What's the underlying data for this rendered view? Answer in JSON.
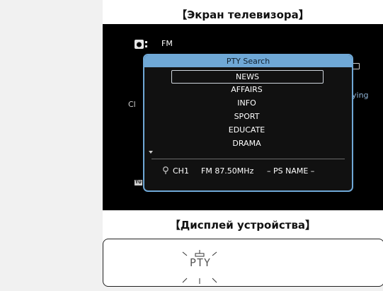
{
  "captions": {
    "tv_screen": "【Экран телевизора】",
    "device_display": "【Дисплей устройства】"
  },
  "tv": {
    "band": "FM",
    "left_text": "Cl",
    "right_text": "ying",
    "tu_badge": "TU",
    "icons": [
      "tuner-icon",
      "display-icon"
    ]
  },
  "dialog": {
    "title": "PTY Search",
    "items": [
      "NEWS",
      "AFFAIRS",
      "INFO",
      "SPORT",
      "EDUCATE",
      "DRAMA"
    ],
    "selected_item": "NEWS",
    "status": {
      "channel": "CH1",
      "frequency": "FM 87.50MHz",
      "ps_name": "– PS NAME –"
    },
    "colors": {
      "accent": "#6fa8d6",
      "background": "#111111"
    }
  },
  "device": {
    "display_text": "PTY"
  }
}
